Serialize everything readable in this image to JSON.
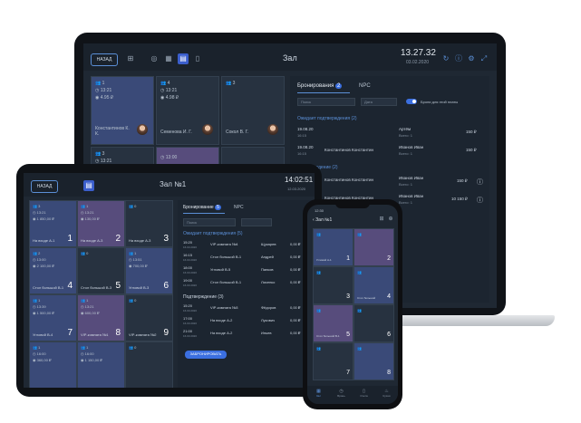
{
  "laptop": {
    "back_label": "НАЗАД",
    "title": "Зал",
    "time": "13.27.32",
    "date": "03.02.2020",
    "tables": [
      {
        "guests": "1",
        "time": "13:21",
        "sum": "4.95 ₽",
        "name": "Константинов К. К."
      },
      {
        "guests": "4",
        "time": "13:21",
        "sum": "4.98 ₽",
        "name": "Семенова И. Г."
      },
      {
        "guests": "3",
        "time": "",
        "sum": "",
        "name": "Сокол В. Г."
      },
      {
        "guests": "3",
        "time": "13:21",
        "sum": "",
        "name": ""
      },
      {
        "guests": "",
        "time": "13:00",
        "sum": "",
        "name": ""
      }
    ],
    "panel": {
      "tab_bookings": "Бронирования",
      "tab_bookings_count": "2",
      "tab_npc": "NPC",
      "search_placeholder": "Поиск",
      "date_placeholder": "Дата",
      "toggle_label": "Брони для этой платы",
      "section_pending": "Ожидает подтверждения (2)",
      "section_confirmed": "Подтверждение (2)",
      "pending_rows": [
        {
          "time": "19.08.20",
          "sub": "16:15",
          "name": "",
          "guest": "Артём",
          "guest_sub": "Всего: 1",
          "sum": "150 ₽"
        },
        {
          "time": "19.08.20",
          "sub": "16:15",
          "name": "Константинов Константин",
          "guest": "Иванов Иван",
          "guest_sub": "Всего: 1",
          "sum": "150 ₽"
        }
      ],
      "confirmed_rows": [
        {
          "time": "",
          "sub": "",
          "name": "Константинов Константин",
          "guest": "Иванов Иван",
          "guest_sub": "Всего: 1",
          "sum": "150 ₽"
        },
        {
          "time": "",
          "sub": "",
          "name": "Константинов Константин",
          "guest": "Иванов Иван",
          "guest_sub": "Всего: 1",
          "sum": "10 150 ₽"
        }
      ]
    }
  },
  "tablet": {
    "back_label": "НАЗАД",
    "title": "Зал №1",
    "time": "14:02:51",
    "date": "12.03.2020",
    "tables": [
      {
        "num": "1",
        "color": "blue",
        "guests": "3",
        "time": "13:21",
        "sum": "1 850,00 ₽",
        "name": "На входе А-1"
      },
      {
        "num": "2",
        "color": "purple",
        "guests": "1",
        "time": "13:21",
        "sum": "130,00 ₽",
        "name": "На входе А-3"
      },
      {
        "num": "3",
        "color": "plain",
        "guests": "0",
        "time": "",
        "sum": "",
        "name": "На входе А-3"
      },
      {
        "num": "4",
        "color": "blue",
        "guests": "2",
        "time": "13:00",
        "sum": "2 100,00 ₽",
        "name": "Стол большой В-1"
      },
      {
        "num": "5",
        "color": "plain",
        "guests": "0",
        "time": "",
        "sum": "",
        "name": "Стол большой В-3"
      },
      {
        "num": "6",
        "color": "blue",
        "guests": "1",
        "time": "13:51",
        "sum": "700,00 ₽",
        "name": "Угловой В-3"
      },
      {
        "num": "7",
        "color": "blue",
        "guests": "1",
        "time": "13:39",
        "sum": "1 500,00 ₽",
        "name": "Угловой В-4"
      },
      {
        "num": "8",
        "color": "purple",
        "guests": "1",
        "time": "13:21",
        "sum": "600,00 ₽",
        "name": "VIP-комната №1"
      },
      {
        "num": "9",
        "color": "plain",
        "guests": "0",
        "time": "",
        "sum": "",
        "name": "VIP-комната №2"
      },
      {
        "num": "",
        "color": "blue",
        "guests": "1",
        "time": "16:00",
        "sum": "360,00 ₽",
        "name": ""
      },
      {
        "num": "",
        "color": "blue",
        "guests": "1",
        "time": "16:00",
        "sum": "1 150,00 ₽",
        "name": ""
      },
      {
        "num": "",
        "color": "plain",
        "guests": "0",
        "time": "",
        "sum": "",
        "name": ""
      }
    ],
    "panel": {
      "tab_bookings": "Бронирование",
      "tab_bookings_count": "5",
      "tab_npc": "NPC",
      "search_placeholder": "Поиск",
      "section_pending": "Ожидает подтверждения (5)",
      "section_confirmed": "Подтверждение (3)",
      "pending_rows": [
        {
          "time": "15:20",
          "sub": "16.03.2020",
          "table": "VIP-комната №4",
          "guest": "Щукарев",
          "sum": "0,00 ₽"
        },
        {
          "time": "16:15",
          "sub": "16.03.2020",
          "table": "Стол большой В-1",
          "guest": "Андрей",
          "sum": "0,00 ₽"
        },
        {
          "time": "18:00",
          "sub": "16.03.2020",
          "table": "Угловой В-5",
          "guest": "Панков",
          "sum": "0,00 ₽"
        },
        {
          "time": "19:00",
          "sub": "16.03.2020",
          "table": "Стол большой В-1",
          "guest": "Лисенко",
          "sum": "0,00 ₽"
        }
      ],
      "confirmed_rows": [
        {
          "time": "15:20",
          "sub": "16.03.2020",
          "table": "VIP-комната №3",
          "guest": "Фёдоров",
          "sum": "0,00 ₽"
        },
        {
          "time": "17:00",
          "sub": "16.03.2020",
          "table": "На входе А-2",
          "guest": "Лукович",
          "sum": "0,00 ₽"
        },
        {
          "time": "21:00",
          "sub": "16.03.2020",
          "table": "На входе А-2",
          "guest": "Иньев",
          "sum": "0,00 ₽"
        }
      ],
      "add_button": "ЗАБРОНИРОВАТЬ"
    }
  },
  "phone": {
    "status_time": "12:30",
    "title": "Зал №1",
    "tables": [
      {
        "num": "1",
        "color": "blue",
        "name": "Угловой А-1"
      },
      {
        "num": "2",
        "color": "purple",
        "name": ""
      },
      {
        "num": "3",
        "color": "plain",
        "name": ""
      },
      {
        "num": "4",
        "color": "blue",
        "name": "Стол большой"
      },
      {
        "num": "5",
        "color": "purple",
        "name": "Стол большой В-1"
      },
      {
        "num": "6",
        "color": "plain",
        "name": ""
      },
      {
        "num": "7",
        "color": "plain",
        "name": ""
      },
      {
        "num": "8",
        "color": "blue",
        "name": ""
      }
    ],
    "nav": [
      "Зал",
      "Бронь",
      "Счета",
      "Кухня"
    ]
  }
}
